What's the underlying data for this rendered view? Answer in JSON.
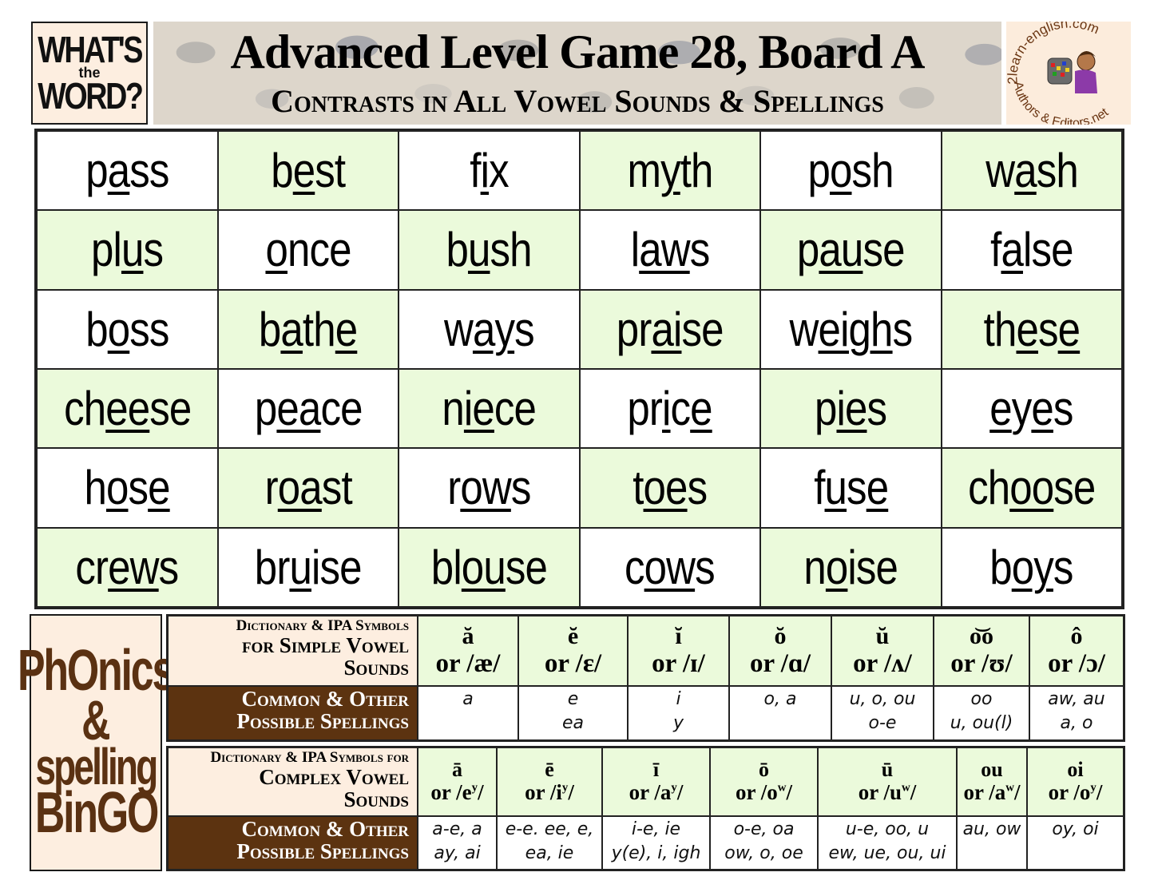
{
  "header": {
    "logo_left": {
      "line1": "WHAT'S",
      "line2": "the",
      "line3": "WORD?"
    },
    "title": "Advanced Level Game 28, Board A",
    "subtitle": "Contrasts in All Vowel Sounds & Spellings",
    "logo_right": {
      "top_text": "2learn-english.com",
      "bottom_text": "Authors & Editors.net"
    }
  },
  "colors": {
    "green_cell": "#ebfadb",
    "white_cell": "#ffffff",
    "cream": "#fdeee0",
    "brown": "#5c3310",
    "logo_brown": "#5a3112"
  },
  "bingo": {
    "rows": [
      [
        {
          "parts": [
            [
              "p",
              0
            ],
            [
              "a",
              1
            ],
            [
              "ss",
              0
            ]
          ],
          "word": "pass",
          "green": false
        },
        {
          "parts": [
            [
              "b",
              0
            ],
            [
              "e",
              1
            ],
            [
              "st",
              0
            ]
          ],
          "word": "best",
          "green": true
        },
        {
          "parts": [
            [
              "f",
              0
            ],
            [
              "i",
              1
            ],
            [
              "x",
              0
            ]
          ],
          "word": "fix",
          "green": false
        },
        {
          "parts": [
            [
              "m",
              0
            ],
            [
              "y",
              1
            ],
            [
              "th",
              0
            ]
          ],
          "word": "myth",
          "green": true
        },
        {
          "parts": [
            [
              "p",
              0
            ],
            [
              "o",
              1
            ],
            [
              "sh",
              0
            ]
          ],
          "word": "posh",
          "green": false
        },
        {
          "parts": [
            [
              "w",
              0
            ],
            [
              "a",
              1
            ],
            [
              "sh",
              0
            ]
          ],
          "word": "wash",
          "green": true
        }
      ],
      [
        {
          "parts": [
            [
              "pl",
              0
            ],
            [
              "u",
              1
            ],
            [
              "s",
              0
            ]
          ],
          "word": "plus",
          "green": true
        },
        {
          "parts": [
            [
              "o",
              1
            ],
            [
              "nce",
              0
            ]
          ],
          "word": "once",
          "green": false
        },
        {
          "parts": [
            [
              "b",
              0
            ],
            [
              "u",
              1
            ],
            [
              "sh",
              0
            ]
          ],
          "word": "bush",
          "green": true
        },
        {
          "parts": [
            [
              "l",
              0
            ],
            [
              "aw",
              1
            ],
            [
              "s",
              0
            ]
          ],
          "word": "laws",
          "green": false
        },
        {
          "parts": [
            [
              "p",
              0
            ],
            [
              "au",
              1
            ],
            [
              "se",
              0
            ]
          ],
          "word": "pause",
          "green": true
        },
        {
          "parts": [
            [
              "f",
              0
            ],
            [
              "a",
              1
            ],
            [
              "lse",
              0
            ]
          ],
          "word": "false",
          "green": false
        }
      ],
      [
        {
          "parts": [
            [
              "b",
              0
            ],
            [
              "o",
              1
            ],
            [
              "ss",
              0
            ]
          ],
          "word": "boss",
          "green": false
        },
        {
          "parts": [
            [
              "b",
              0
            ],
            [
              "a",
              1
            ],
            [
              "th",
              0
            ],
            [
              "e",
              1
            ]
          ],
          "word": "bathe",
          "green": true
        },
        {
          "parts": [
            [
              "w",
              0
            ],
            [
              "ay",
              1
            ],
            [
              "s",
              0
            ]
          ],
          "word": "ways",
          "green": false
        },
        {
          "parts": [
            [
              "pr",
              0
            ],
            [
              "ai",
              1
            ],
            [
              "se",
              0
            ]
          ],
          "word": "praise",
          "green": true
        },
        {
          "parts": [
            [
              "w",
              0
            ],
            [
              "eigh",
              1
            ],
            [
              "s",
              0
            ]
          ],
          "word": "weighs",
          "green": false
        },
        {
          "parts": [
            [
              "th",
              0
            ],
            [
              "e",
              1
            ],
            [
              "s",
              0
            ],
            [
              "e",
              1
            ]
          ],
          "word": "these",
          "green": true
        }
      ],
      [
        {
          "parts": [
            [
              "ch",
              0
            ],
            [
              "ee",
              1
            ],
            [
              "se",
              0
            ]
          ],
          "word": "cheese",
          "green": true
        },
        {
          "parts": [
            [
              "p",
              0
            ],
            [
              "ea",
              1
            ],
            [
              "ce",
              0
            ]
          ],
          "word": "peace",
          "green": false
        },
        {
          "parts": [
            [
              "n",
              0
            ],
            [
              "ie",
              1
            ],
            [
              "ce",
              0
            ]
          ],
          "word": "niece",
          "green": true
        },
        {
          "parts": [
            [
              "pr",
              0
            ],
            [
              "i",
              1
            ],
            [
              "c",
              0
            ],
            [
              "e",
              1
            ]
          ],
          "word": "price",
          "green": false
        },
        {
          "parts": [
            [
              "p",
              0
            ],
            [
              "ie",
              1
            ],
            [
              "s",
              0
            ]
          ],
          "word": "pies",
          "green": true
        },
        {
          "parts": [
            [
              "e",
              1
            ],
            [
              "y",
              0
            ],
            [
              "e",
              1
            ],
            [
              "s",
              0
            ]
          ],
          "word": "eyes",
          "green": false
        }
      ],
      [
        {
          "parts": [
            [
              "h",
              0
            ],
            [
              "o",
              1
            ],
            [
              "s",
              0
            ],
            [
              "e",
              1
            ]
          ],
          "word": "hose",
          "green": false
        },
        {
          "parts": [
            [
              "r",
              0
            ],
            [
              "oa",
              1
            ],
            [
              "st",
              0
            ]
          ],
          "word": "roast",
          "green": true
        },
        {
          "parts": [
            [
              "r",
              0
            ],
            [
              "ow",
              1
            ],
            [
              "s",
              0
            ]
          ],
          "word": "rows",
          "green": false
        },
        {
          "parts": [
            [
              "t",
              0
            ],
            [
              "oe",
              1
            ],
            [
              "s",
              0
            ]
          ],
          "word": "toes",
          "green": true
        },
        {
          "parts": [
            [
              "f",
              0
            ],
            [
              "u",
              1
            ],
            [
              "s",
              0
            ],
            [
              "e",
              1
            ]
          ],
          "word": "fuse",
          "green": false
        },
        {
          "parts": [
            [
              "ch",
              0
            ],
            [
              "oo",
              1
            ],
            [
              "se",
              0
            ]
          ],
          "word": "choose",
          "green": true
        }
      ],
      [
        {
          "parts": [
            [
              "cr",
              0
            ],
            [
              "ew",
              1
            ],
            [
              "s",
              0
            ]
          ],
          "word": "crews",
          "green": true
        },
        {
          "parts": [
            [
              "br",
              0
            ],
            [
              "u",
              1
            ],
            [
              "ise",
              0
            ]
          ],
          "word": "bruise",
          "green": false
        },
        {
          "parts": [
            [
              "bl",
              0
            ],
            [
              "ou",
              1
            ],
            [
              "se",
              0
            ]
          ],
          "word": "blouse",
          "green": true
        },
        {
          "parts": [
            [
              "c",
              0
            ],
            [
              "ow",
              1
            ],
            [
              "s",
              0
            ]
          ],
          "word": "cows",
          "green": false
        },
        {
          "parts": [
            [
              "n",
              0
            ],
            [
              "o",
              1
            ],
            [
              "ise",
              0
            ]
          ],
          "word": "noise",
          "green": true
        },
        {
          "parts": [
            [
              "b",
              0
            ],
            [
              "oy",
              1
            ],
            [
              "s",
              0
            ]
          ],
          "word": "boys",
          "green": false
        }
      ]
    ]
  },
  "phonics_logo": {
    "line1": "PhOnics",
    "line2": "&",
    "line3": "spelling",
    "line4": "BinGO"
  },
  "simple_vowels": {
    "label_line1": "Dictionary & IPA Symbols",
    "label_line2": "for  Simple Vowel",
    "label_line3": "Sounds",
    "spell_label_line1": "Common & Other",
    "spell_label_line2": "Possible Spellings",
    "columns": [
      {
        "symbol": "ă",
        "ipa": "or /æ/",
        "spellings": "a"
      },
      {
        "symbol": "ĕ",
        "ipa": "or /ɛ/",
        "spellings": "e\nea"
      },
      {
        "symbol": "ĭ",
        "ipa": "or /ɪ/",
        "spellings": "i\ny"
      },
      {
        "symbol": "ŏ",
        "ipa": "or /ɑ/",
        "spellings": "o, a"
      },
      {
        "symbol": "ŭ",
        "ipa": "or /ʌ/",
        "spellings": "u, o, ou\no-e"
      },
      {
        "symbol": "o͝o",
        "ipa": "or /ʊ/",
        "spellings": "oo\nu, ou(l)"
      },
      {
        "symbol": "ô",
        "ipa": "or /ɔ/",
        "spellings": "aw, au\na, o"
      }
    ]
  },
  "complex_vowels": {
    "label_line1": "Dictionary & IPA Symbols for",
    "label_line2": "Complex Vowel",
    "label_line3": "Sounds",
    "spell_label_line1": "Common & Other",
    "spell_label_line2": "Possible Spellings",
    "columns": [
      {
        "symbol": "ā",
        "ipa_base": "or /e",
        "ipa_sup": "y",
        "spellings": "a-e, a\nay, ai"
      },
      {
        "symbol": "ē",
        "ipa_base": "or /i",
        "ipa_sup": "y",
        "spellings": "e-e. ee, e,\nea, ie"
      },
      {
        "symbol": "ī",
        "ipa_base": "or /a",
        "ipa_sup": "y",
        "spellings": "i-e, ie\ny(e), i, igh"
      },
      {
        "symbol": "ō",
        "ipa_base": "or /o",
        "ipa_sup": "w",
        "spellings": "o-e, oa\now, o, oe"
      },
      {
        "symbol": "ū",
        "ipa_base": "or /u",
        "ipa_sup": "w",
        "spellings": "u-e, oo, u\new, ue, ou, ui"
      },
      {
        "symbol": "ou",
        "ipa_base": "or /a",
        "ipa_sup": "w",
        "spellings": "au, ow"
      },
      {
        "symbol": "oi",
        "ipa_base": "or /o",
        "ipa_sup": "y",
        "spellings": "oy, oi"
      }
    ]
  }
}
